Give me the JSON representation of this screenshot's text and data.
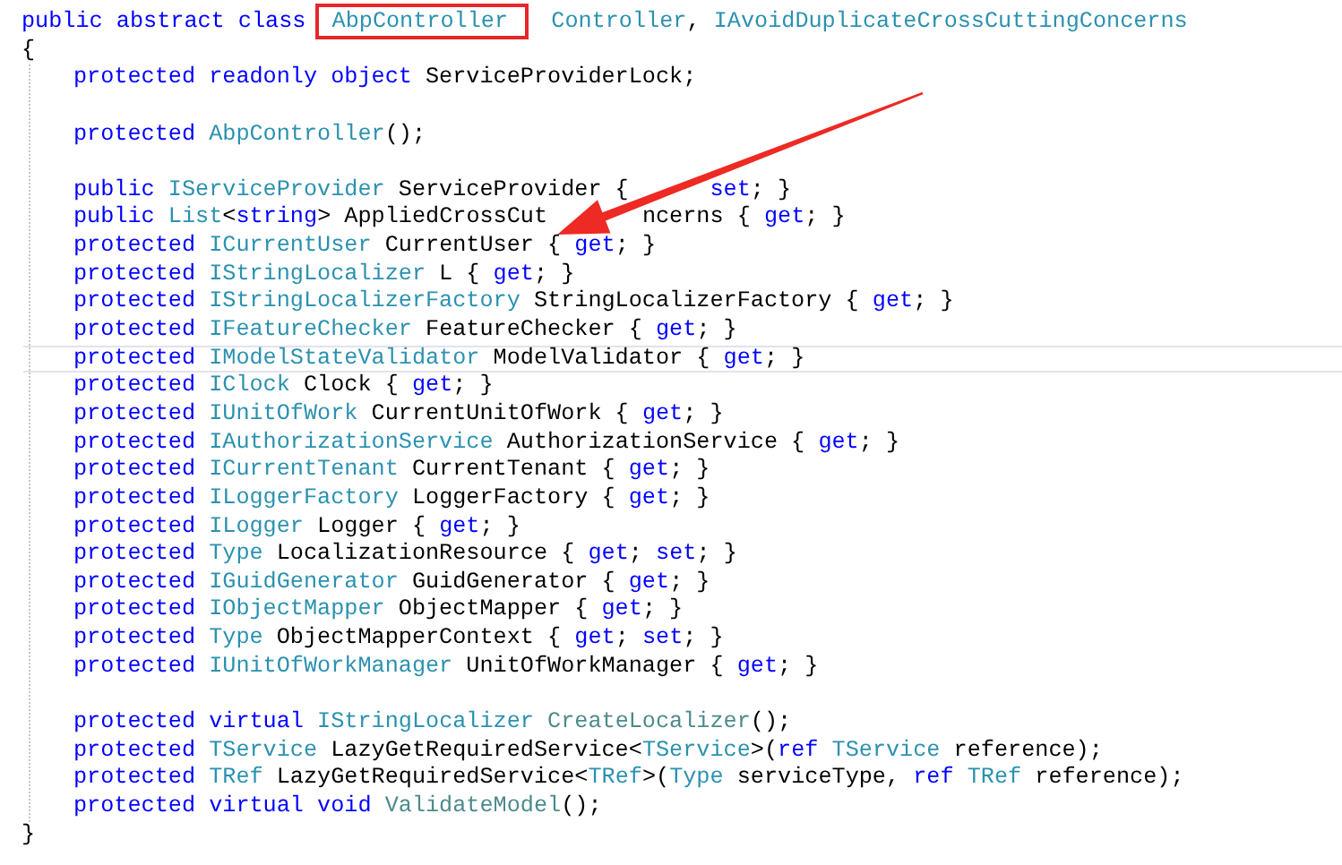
{
  "code": {
    "header": [
      {
        "kind": "keyword",
        "text": "public abstract class "
      },
      {
        "kind": "type",
        "text": "AbpController",
        "boxed": true
      },
      {
        "kind": "type",
        "text": "  Controller"
      },
      {
        "kind": "plain",
        "text": ", "
      },
      {
        "kind": "type",
        "text": "IAvoidDuplicateCrossCuttingConcerns"
      }
    ],
    "open": "{",
    "members": [
      {
        "kind": "code",
        "tokens": [
          {
            "kind": "keyword",
            "text": "protected readonly object "
          },
          {
            "kind": "plain",
            "text": "ServiceProviderLock;"
          }
        ]
      },
      {
        "kind": "blank"
      },
      {
        "kind": "code",
        "tokens": [
          {
            "kind": "keyword",
            "text": "protected "
          },
          {
            "kind": "type",
            "text": "AbpController"
          },
          {
            "kind": "plain",
            "text": "();"
          }
        ]
      },
      {
        "kind": "blank"
      },
      {
        "kind": "code",
        "tokens": [
          {
            "kind": "keyword",
            "text": "public "
          },
          {
            "kind": "type",
            "text": "IServiceProvider"
          },
          {
            "kind": "plain",
            "text": " ServiceProvider {      "
          },
          {
            "kind": "keyword",
            "text": "set"
          },
          {
            "kind": "plain",
            "text": "; }"
          }
        ]
      },
      {
        "kind": "code",
        "tokens": [
          {
            "kind": "keyword",
            "text": "public "
          },
          {
            "kind": "type",
            "text": "List"
          },
          {
            "kind": "plain",
            "text": "<"
          },
          {
            "kind": "keyword",
            "text": "string"
          },
          {
            "kind": "plain",
            "text": "> AppliedCrossCut       ncerns { "
          },
          {
            "kind": "keyword",
            "text": "get"
          },
          {
            "kind": "plain",
            "text": "; }"
          }
        ]
      },
      {
        "kind": "code",
        "tokens": [
          {
            "kind": "keyword",
            "text": "protected "
          },
          {
            "kind": "type",
            "text": "ICurrentUser"
          },
          {
            "kind": "plain",
            "text": " CurrentUser { "
          },
          {
            "kind": "keyword",
            "text": "get"
          },
          {
            "kind": "plain",
            "text": "; }"
          }
        ]
      },
      {
        "kind": "code",
        "tokens": [
          {
            "kind": "keyword",
            "text": "protected "
          },
          {
            "kind": "type",
            "text": "IStringLocalizer"
          },
          {
            "kind": "plain",
            "text": " L { "
          },
          {
            "kind": "keyword",
            "text": "get"
          },
          {
            "kind": "plain",
            "text": "; }"
          }
        ]
      },
      {
        "kind": "code",
        "tokens": [
          {
            "kind": "keyword",
            "text": "protected "
          },
          {
            "kind": "type",
            "text": "IStringLocalizerFactory"
          },
          {
            "kind": "plain",
            "text": " StringLocalizerFactory { "
          },
          {
            "kind": "keyword",
            "text": "get"
          },
          {
            "kind": "plain",
            "text": "; }"
          }
        ]
      },
      {
        "kind": "code",
        "tokens": [
          {
            "kind": "keyword",
            "text": "protected "
          },
          {
            "kind": "type",
            "text": "IFeatureChecker"
          },
          {
            "kind": "plain",
            "text": " FeatureChecker { "
          },
          {
            "kind": "keyword",
            "text": "get"
          },
          {
            "kind": "plain",
            "text": "; }"
          }
        ]
      },
      {
        "kind": "code",
        "current": true,
        "tokens": [
          {
            "kind": "keyword",
            "text": "protected "
          },
          {
            "kind": "type",
            "text": "IModelStateValidator"
          },
          {
            "kind": "plain",
            "text": " ModelValidator { "
          },
          {
            "kind": "keyword",
            "text": "get"
          },
          {
            "kind": "plain",
            "text": "; }"
          }
        ]
      },
      {
        "kind": "code",
        "tokens": [
          {
            "kind": "keyword",
            "text": "protected "
          },
          {
            "kind": "type",
            "text": "IClock"
          },
          {
            "kind": "plain",
            "text": " Clock { "
          },
          {
            "kind": "keyword",
            "text": "get"
          },
          {
            "kind": "plain",
            "text": "; }"
          }
        ]
      },
      {
        "kind": "code",
        "tokens": [
          {
            "kind": "keyword",
            "text": "protected "
          },
          {
            "kind": "type",
            "text": "IUnitOfWork"
          },
          {
            "kind": "plain",
            "text": " CurrentUnitOfWork { "
          },
          {
            "kind": "keyword",
            "text": "get"
          },
          {
            "kind": "plain",
            "text": "; }"
          }
        ]
      },
      {
        "kind": "code",
        "tokens": [
          {
            "kind": "keyword",
            "text": "protected "
          },
          {
            "kind": "type",
            "text": "IAuthorizationService"
          },
          {
            "kind": "plain",
            "text": " AuthorizationService { "
          },
          {
            "kind": "keyword",
            "text": "get"
          },
          {
            "kind": "plain",
            "text": "; }"
          }
        ]
      },
      {
        "kind": "code",
        "tokens": [
          {
            "kind": "keyword",
            "text": "protected "
          },
          {
            "kind": "type",
            "text": "ICurrentTenant"
          },
          {
            "kind": "plain",
            "text": " CurrentTenant { "
          },
          {
            "kind": "keyword",
            "text": "get"
          },
          {
            "kind": "plain",
            "text": "; }"
          }
        ]
      },
      {
        "kind": "code",
        "tokens": [
          {
            "kind": "keyword",
            "text": "protected "
          },
          {
            "kind": "type",
            "text": "ILoggerFactory"
          },
          {
            "kind": "plain",
            "text": " LoggerFactory { "
          },
          {
            "kind": "keyword",
            "text": "get"
          },
          {
            "kind": "plain",
            "text": "; }"
          }
        ]
      },
      {
        "kind": "code",
        "tokens": [
          {
            "kind": "keyword",
            "text": "protected "
          },
          {
            "kind": "type",
            "text": "ILogger"
          },
          {
            "kind": "plain",
            "text": " Logger { "
          },
          {
            "kind": "keyword",
            "text": "get"
          },
          {
            "kind": "plain",
            "text": "; }"
          }
        ]
      },
      {
        "kind": "code",
        "tokens": [
          {
            "kind": "keyword",
            "text": "protected "
          },
          {
            "kind": "type",
            "text": "Type"
          },
          {
            "kind": "plain",
            "text": " LocalizationResource { "
          },
          {
            "kind": "keyword",
            "text": "get"
          },
          {
            "kind": "plain",
            "text": "; "
          },
          {
            "kind": "keyword",
            "text": "set"
          },
          {
            "kind": "plain",
            "text": "; }"
          }
        ]
      },
      {
        "kind": "code",
        "tokens": [
          {
            "kind": "keyword",
            "text": "protected "
          },
          {
            "kind": "type",
            "text": "IGuidGenerator"
          },
          {
            "kind": "plain",
            "text": " GuidGenerator { "
          },
          {
            "kind": "keyword",
            "text": "get"
          },
          {
            "kind": "plain",
            "text": "; }"
          }
        ]
      },
      {
        "kind": "code",
        "tokens": [
          {
            "kind": "keyword",
            "text": "protected "
          },
          {
            "kind": "type",
            "text": "IObjectMapper"
          },
          {
            "kind": "plain",
            "text": " ObjectMapper { "
          },
          {
            "kind": "keyword",
            "text": "get"
          },
          {
            "kind": "plain",
            "text": "; }"
          }
        ]
      },
      {
        "kind": "code",
        "tokens": [
          {
            "kind": "keyword",
            "text": "protected "
          },
          {
            "kind": "type",
            "text": "Type"
          },
          {
            "kind": "plain",
            "text": " ObjectMapperContext { "
          },
          {
            "kind": "keyword",
            "text": "get"
          },
          {
            "kind": "plain",
            "text": "; "
          },
          {
            "kind": "keyword",
            "text": "set"
          },
          {
            "kind": "plain",
            "text": "; }"
          }
        ]
      },
      {
        "kind": "code",
        "tokens": [
          {
            "kind": "keyword",
            "text": "protected "
          },
          {
            "kind": "type",
            "text": "IUnitOfWorkManager"
          },
          {
            "kind": "plain",
            "text": " UnitOfWorkManager { "
          },
          {
            "kind": "keyword",
            "text": "get"
          },
          {
            "kind": "plain",
            "text": "; }"
          }
        ]
      },
      {
        "kind": "blank"
      },
      {
        "kind": "code",
        "tokens": [
          {
            "kind": "keyword",
            "text": "protected virtual "
          },
          {
            "kind": "type",
            "text": "IStringLocalizer"
          },
          {
            "kind": "method",
            "text": " CreateLocalizer"
          },
          {
            "kind": "plain",
            "text": "();"
          }
        ]
      },
      {
        "kind": "code",
        "tokens": [
          {
            "kind": "keyword",
            "text": "protected "
          },
          {
            "kind": "type",
            "text": "TService"
          },
          {
            "kind": "plain",
            "text": " LazyGetRequiredService<"
          },
          {
            "kind": "type",
            "text": "TService"
          },
          {
            "kind": "plain",
            "text": ">("
          },
          {
            "kind": "keyword",
            "text": "ref "
          },
          {
            "kind": "type",
            "text": "TService"
          },
          {
            "kind": "plain",
            "text": " reference);"
          }
        ]
      },
      {
        "kind": "code",
        "tokens": [
          {
            "kind": "keyword",
            "text": "protected "
          },
          {
            "kind": "type",
            "text": "TRef"
          },
          {
            "kind": "plain",
            "text": " LazyGetRequiredService<"
          },
          {
            "kind": "type",
            "text": "TRef"
          },
          {
            "kind": "plain",
            "text": ">("
          },
          {
            "kind": "type",
            "text": "Type"
          },
          {
            "kind": "plain",
            "text": " serviceType, "
          },
          {
            "kind": "keyword",
            "text": "ref "
          },
          {
            "kind": "type",
            "text": "TRef"
          },
          {
            "kind": "plain",
            "text": " reference);"
          }
        ]
      },
      {
        "kind": "code",
        "tokens": [
          {
            "kind": "keyword",
            "text": "protected virtual void "
          },
          {
            "kind": "method",
            "text": "ValidateModel"
          },
          {
            "kind": "plain",
            "text": "();"
          }
        ]
      }
    ],
    "close": "}"
  }
}
